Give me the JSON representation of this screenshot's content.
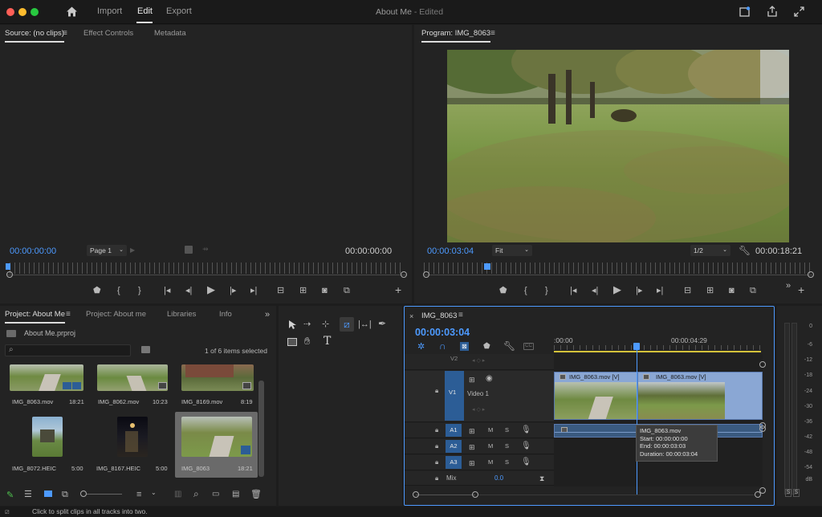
{
  "titlebar": {
    "tabs": [
      "Import",
      "Edit",
      "Export"
    ],
    "active_tab": "Edit",
    "doc_title": "About Me",
    "doc_status": "- Edited"
  },
  "source": {
    "tabs": [
      "Source: (no clips)",
      "Effect Controls",
      "Metadata"
    ],
    "timecode_left": "00:00:00:00",
    "page_select": "Page 1",
    "timecode_right": "00:00:00:00"
  },
  "program": {
    "tab": "Program: IMG_8063",
    "timecode": "00:00:03:04",
    "fit": "Fit",
    "resolution": "1/2",
    "duration": "00:00:18:21"
  },
  "project": {
    "tabs": [
      "Project: About Me",
      "Project: About me",
      "Libraries",
      "Info"
    ],
    "file": "About Me.prproj",
    "selection_status": "1 of 6 items selected",
    "search_placeholder": "",
    "items": [
      {
        "name": "IMG_8063.mov",
        "duration": "18:21"
      },
      {
        "name": "IMG_8062.mov",
        "duration": "10:23"
      },
      {
        "name": "IMG_8169.mov",
        "duration": "8:19"
      },
      {
        "name": "IMG_8072.HEIC",
        "duration": "5:00"
      },
      {
        "name": "IMG_8167.HEIC",
        "duration": "5:00"
      },
      {
        "name": "IMG_8063",
        "duration": "18:21"
      }
    ]
  },
  "timeline": {
    "tab": "IMG_8063",
    "timecode": "00:00:03:04",
    "ruler_labels": [
      ":00:00",
      "00:00:04:29"
    ],
    "tracks": {
      "v2": "V2",
      "v1": "V1",
      "v1_name": "Video 1",
      "a1": "A1",
      "a2": "A2",
      "a3": "A3",
      "mix": "Mix",
      "mix_value": "0.0"
    },
    "toggle_m": "M",
    "toggle_s": "S",
    "clip_left_label": "IMG_8063.mov [V]",
    "clip_right_label": "IMG_8063.mov [V]",
    "tooltip": {
      "title": "IMG_8063.mov",
      "start": "Start: 00:00:00:00",
      "end": "End: 00:00:03:03",
      "duration": "Duration: 00:00:03:04"
    }
  },
  "meter": {
    "labels": [
      "0",
      "-6",
      "-12",
      "-18",
      "-24",
      "-30",
      "-36",
      "-42",
      "-48",
      "-54",
      "dB"
    ],
    "solo_left": "S",
    "solo_right": "S"
  },
  "statusbar": {
    "text": "Click to split clips in all tracks into two."
  },
  "colors": {
    "accent": "#4d9aff",
    "track_badge": "#2c5d96",
    "clip": "#8aa7d4",
    "playhead": "#4d9aff"
  }
}
